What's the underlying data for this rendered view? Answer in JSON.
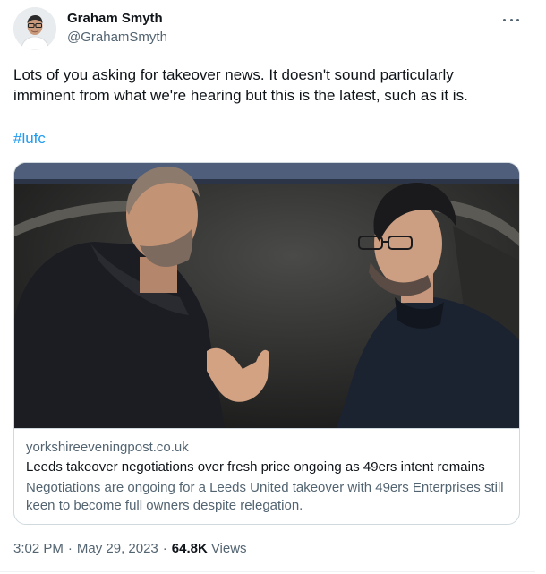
{
  "author": {
    "name": "Graham Smyth",
    "handle": "@GrahamSmyth"
  },
  "tweet": {
    "text": "Lots of you asking for takeover news. It doesn't sound particularly imminent from what we're hearing but this is the latest, such as it is.",
    "hashtag": "#lufc"
  },
  "card": {
    "domain": "yorkshireeveningpost.co.uk",
    "title": "Leeds takeover negotiations over fresh price ongoing as 49ers intent remains",
    "description": "Negotiations are ongoing for a Leeds United takeover with 49ers Enterprises still keen to become full owners despite relegation."
  },
  "meta": {
    "time": "3:02 PM",
    "separator": "·",
    "date": "May 29, 2023",
    "views_count": "64.8K",
    "views_label": "Views"
  },
  "colors": {
    "link": "#1d9bf0",
    "secondary_text": "#536471",
    "primary_text": "#0f1419",
    "border": "#cfd9de"
  },
  "icons": [
    "more-options-icon"
  ]
}
